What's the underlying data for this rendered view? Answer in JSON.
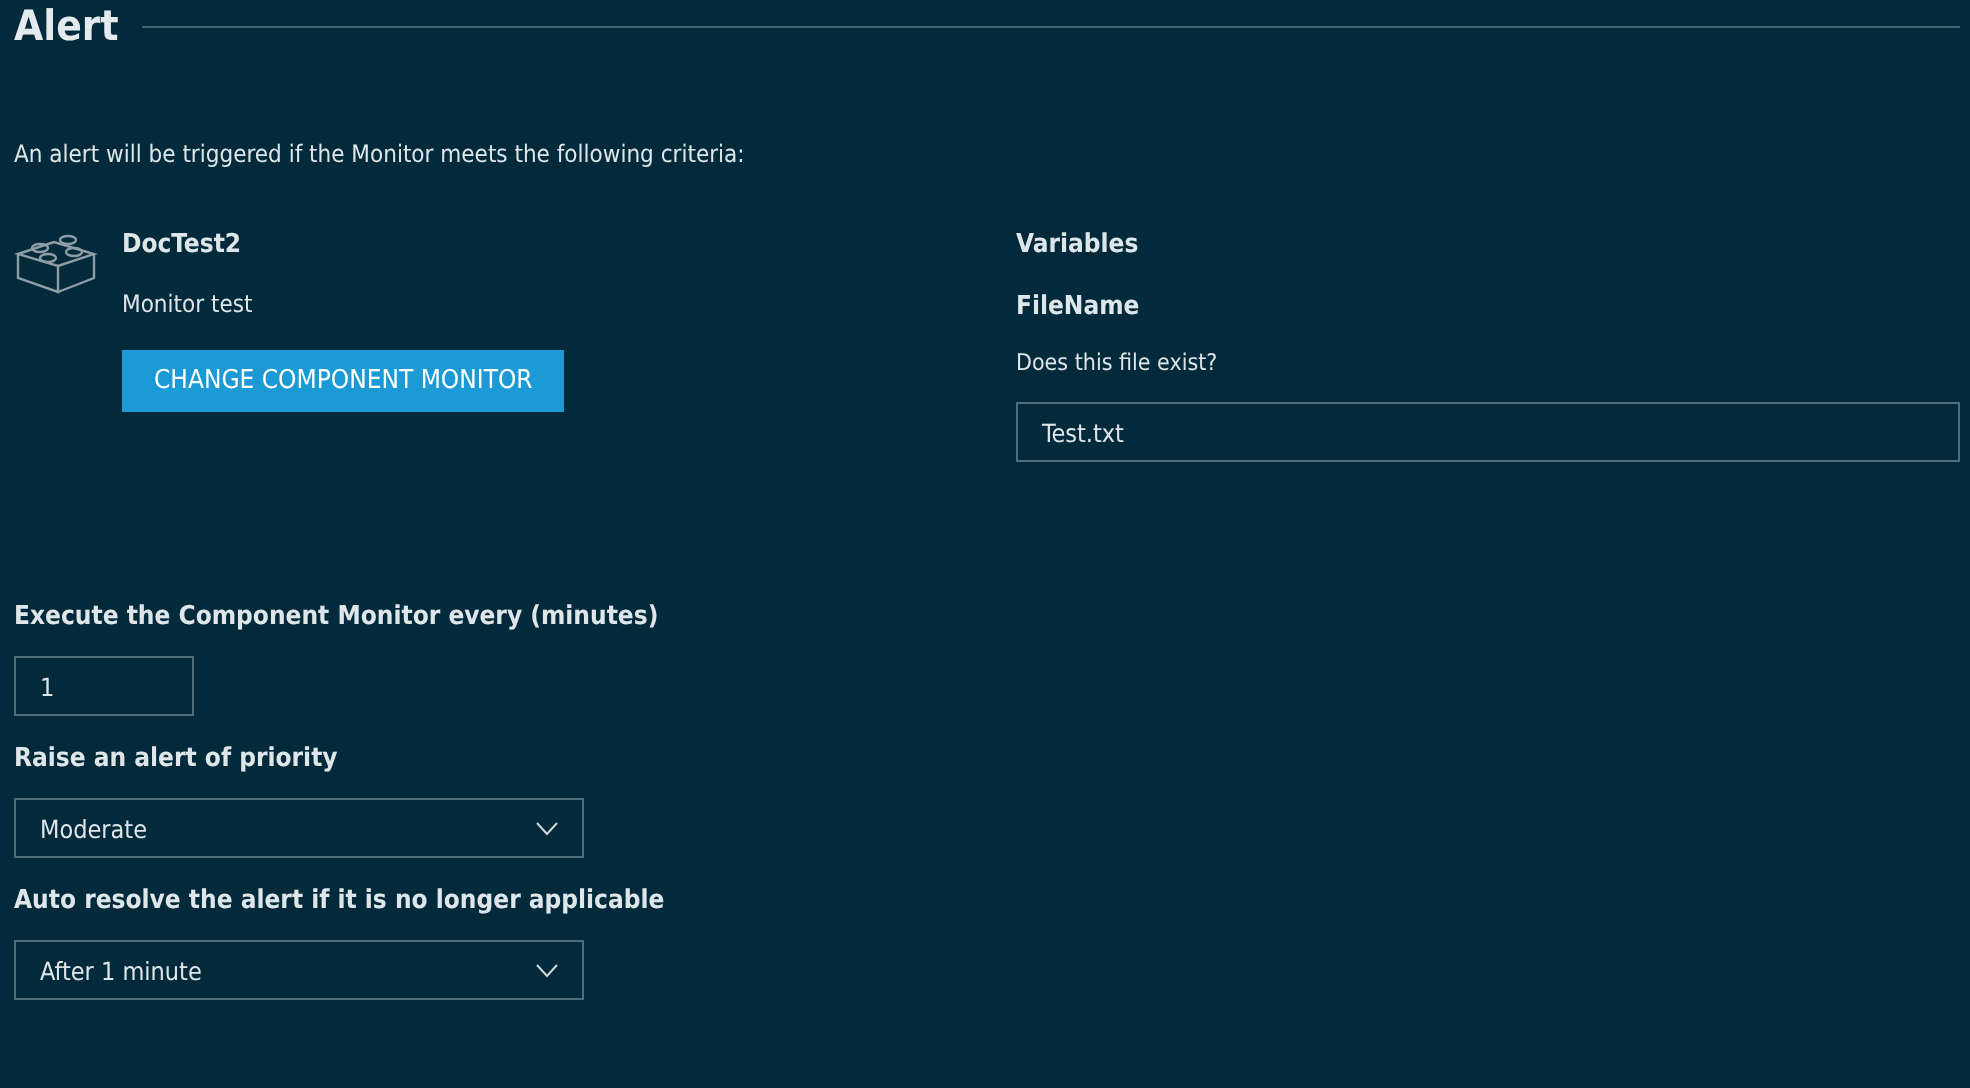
{
  "title": "Alert",
  "description": "An alert will be triggered if the Monitor meets the following criteria:",
  "monitor": {
    "name": "DocTest2",
    "subtitle": "Monitor test",
    "button": "CHANGE COMPONENT MONITOR"
  },
  "variables": {
    "heading": "Variables",
    "items": [
      {
        "name": "FileName",
        "hint": "Does this file exist?",
        "value": "Test.txt"
      }
    ]
  },
  "settings": [
    {
      "kind": "input",
      "label": "Execute the Component Monitor every (minutes)",
      "value": "1"
    },
    {
      "kind": "select",
      "label": "Raise an alert of priority",
      "value": "Moderate"
    },
    {
      "kind": "select",
      "label": "Auto resolve the alert if it is no longer applicable",
      "value": "After 1 minute"
    }
  ]
}
